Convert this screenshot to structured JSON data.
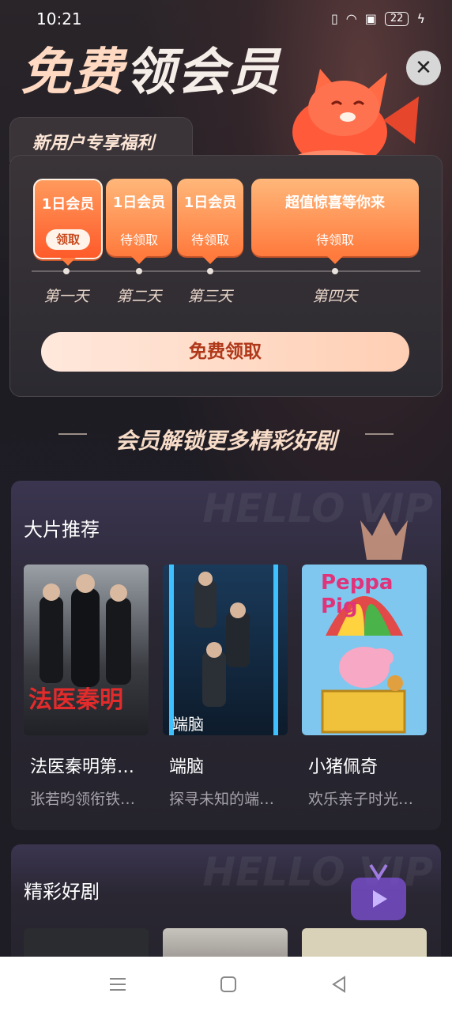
{
  "status": {
    "time": "10:21",
    "battery": "22"
  },
  "header": {
    "title_part1": "免费",
    "title_part2": "领会员",
    "close": "✕"
  },
  "welfare": {
    "tab": "新用户专享福利",
    "days": [
      {
        "title": "1日会员",
        "action": "领取",
        "label": "第一天"
      },
      {
        "title": "1日会员",
        "action": "待领取",
        "label": "第二天"
      },
      {
        "title": "1日会员",
        "action": "待领取",
        "label": "第三天"
      },
      {
        "title": "超值惊喜等你来",
        "action": "待领取",
        "label": "第四天"
      }
    ],
    "claim_button": "免费领取"
  },
  "unlock_title": "会员解锁更多精彩好剧",
  "sections": [
    {
      "title": "大片推荐",
      "items": [
        {
          "title": "法医秦明第…",
          "subtitle": "张若昀领衔铁…",
          "poster_text": "法医秦明"
        },
        {
          "title": "端脑",
          "subtitle": "探寻未知的端…",
          "poster_text": "端脑"
        },
        {
          "title": "小猪佩奇",
          "subtitle": "欢乐亲子时光…",
          "poster_text": "Peppa Pig"
        }
      ]
    },
    {
      "title": "精彩好剧"
    }
  ],
  "colors": {
    "accent": "#ff7a3c",
    "claim_text": "#b0381a"
  }
}
